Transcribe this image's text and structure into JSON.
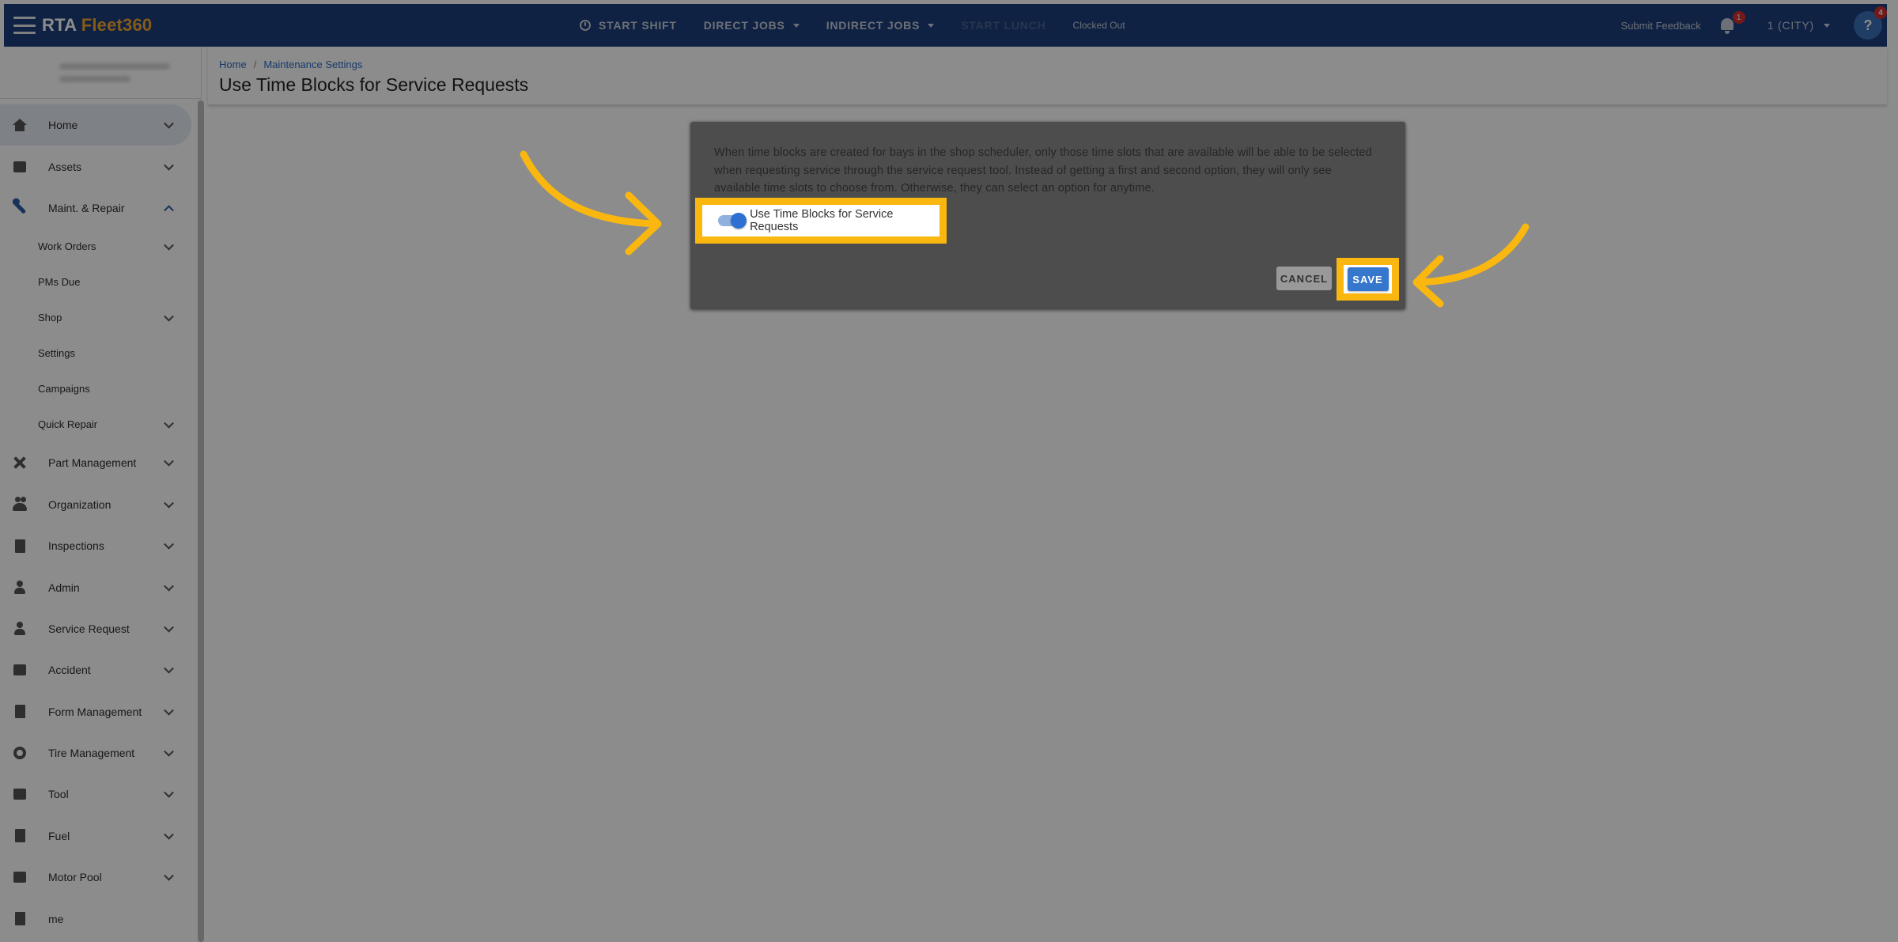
{
  "topbar": {
    "brand_part1": "RTA ",
    "brand_part2": "Fleet360",
    "start_shift": "START SHIFT",
    "direct_jobs": "DIRECT JOBS",
    "indirect_jobs": "INDIRECT JOBS",
    "start_lunch": "START LUNCH",
    "status": "Clocked Out",
    "submit_feedback": "Submit Feedback",
    "notification_count": "1",
    "city": "1 (CITY)",
    "help_badge": "4"
  },
  "sidebar": {
    "items": [
      {
        "label": "Home",
        "icon": "home-icon"
      },
      {
        "label": "Assets",
        "icon": "assets-icon"
      },
      {
        "label": "Maint. & Repair",
        "icon": "wrench-icon"
      },
      {
        "label": "Work Orders"
      },
      {
        "label": "PMs Due"
      },
      {
        "label": "Shop"
      },
      {
        "label": "Settings"
      },
      {
        "label": "Campaigns"
      },
      {
        "label": "Quick Repair"
      },
      {
        "label": "Part Management",
        "icon": "tools-icon"
      },
      {
        "label": "Organization",
        "icon": "people-icon"
      },
      {
        "label": "Inspections",
        "icon": "clipboard-icon"
      },
      {
        "label": "Admin",
        "icon": "admin-icon"
      },
      {
        "label": "Service Request",
        "icon": "person-icon"
      },
      {
        "label": "Accident",
        "icon": "car-icon"
      },
      {
        "label": "Form Management",
        "icon": "form-icon"
      },
      {
        "label": "Tire Management",
        "icon": "tire-icon"
      },
      {
        "label": "Tool",
        "icon": "toolbox-icon"
      },
      {
        "label": "Fuel",
        "icon": "fuel-icon"
      },
      {
        "label": "Motor Pool",
        "icon": "car-icon"
      },
      {
        "label": "me",
        "icon": "document-icon"
      }
    ]
  },
  "breadcrumb": {
    "home": "Home",
    "separator": "/",
    "current": "Maintenance Settings"
  },
  "page_title": "Use Time Blocks for Service Requests",
  "card": {
    "description": "When time blocks are created for bays in the shop scheduler, only those time slots that are available will be able to be selected when requesting service through the service request tool. Instead of getting a first and second option, they will only see available time slots to choose from. Otherwise, they can select an option for anytime.",
    "toggle_label": "Use Time Blocks for Service Requests",
    "toggle_on": true,
    "cancel": "CANCEL",
    "save": "SAVE"
  },
  "colors": {
    "topbar": "#1d3f7a",
    "accent": "#f2a72c",
    "highlight": "#f9b70f",
    "primary": "#3577cc"
  }
}
